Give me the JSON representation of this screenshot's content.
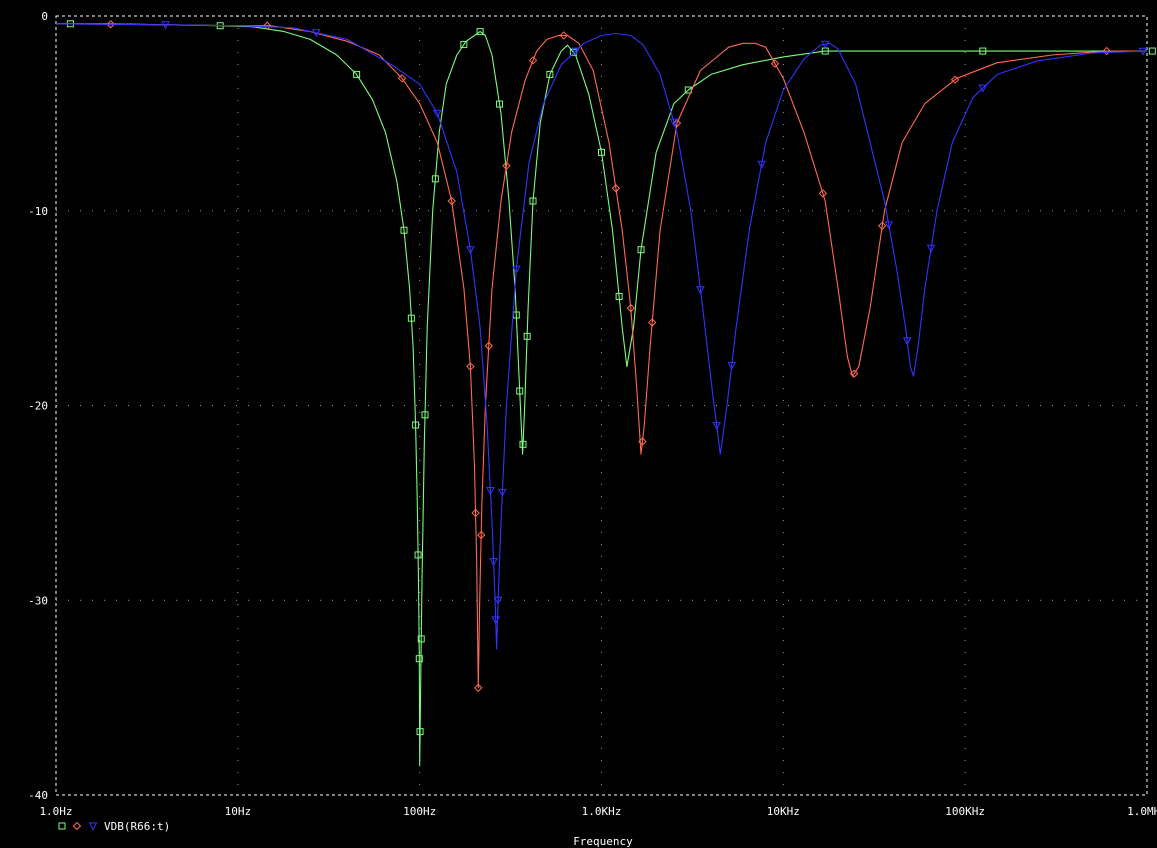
{
  "window": {},
  "chart_data": {
    "type": "line",
    "xscale": "log",
    "xlim": [
      1,
      1000000
    ],
    "ylim": [
      -40,
      0
    ],
    "xlabel": "Frequency",
    "ylabel": "",
    "grid": true,
    "x_ticks": [
      {
        "value": 1,
        "label": "1.0Hz"
      },
      {
        "value": 10,
        "label": "10Hz"
      },
      {
        "value": 100,
        "label": "100Hz"
      },
      {
        "value": 1000,
        "label": "1.0KHz"
      },
      {
        "value": 10000,
        "label": "10KHz"
      },
      {
        "value": 100000,
        "label": "100KHz"
      },
      {
        "value": 1000000,
        "label": "1.0MHz"
      }
    ],
    "y_ticks": [
      {
        "value": 0,
        "label": "0"
      },
      {
        "value": -10,
        "label": "-10"
      },
      {
        "value": -20,
        "label": "-20"
      },
      {
        "value": -30,
        "label": "-30"
      },
      {
        "value": -40,
        "label": "-40"
      }
    ],
    "legend": {
      "placement": "bottom-left",
      "text": "VDB(R66:t)"
    },
    "series": [
      {
        "color": "#7cfc7c",
        "marker": "square",
        "points": [
          [
            1.0,
            -0.4
          ],
          [
            2.0,
            -0.4
          ],
          [
            4.0,
            -0.45
          ],
          [
            8.0,
            -0.5
          ],
          [
            12,
            -0.55
          ],
          [
            18,
            -0.8
          ],
          [
            25,
            -1.2
          ],
          [
            35,
            -2.0
          ],
          [
            45,
            -3.0
          ],
          [
            55,
            -4.3
          ],
          [
            65,
            -6.0
          ],
          [
            75,
            -8.5
          ],
          [
            82,
            -11
          ],
          [
            88,
            -14
          ],
          [
            92,
            -17
          ],
          [
            95,
            -21
          ],
          [
            97,
            -25
          ],
          [
            98.5,
            -29
          ],
          [
            99.5,
            -33
          ],
          [
            100,
            -38.5
          ],
          [
            101,
            -35
          ],
          [
            103,
            -29
          ],
          [
            106,
            -22
          ],
          [
            110,
            -16
          ],
          [
            118,
            -10
          ],
          [
            128,
            -6
          ],
          [
            140,
            -3.5
          ],
          [
            160,
            -2.0
          ],
          [
            180,
            -1.3
          ],
          [
            200,
            -1.0
          ],
          [
            215,
            -0.8
          ],
          [
            230,
            -1.0
          ],
          [
            250,
            -2.0
          ],
          [
            280,
            -5.0
          ],
          [
            310,
            -9.5
          ],
          [
            335,
            -14
          ],
          [
            350,
            -18
          ],
          [
            360,
            -20.5
          ],
          [
            368,
            -22.5
          ],
          [
            378,
            -20
          ],
          [
            395,
            -15
          ],
          [
            420,
            -9.5
          ],
          [
            460,
            -5.5
          ],
          [
            520,
            -3
          ],
          [
            600,
            -1.8
          ],
          [
            650,
            -1.5
          ],
          [
            720,
            -2
          ],
          [
            850,
            -4
          ],
          [
            1000,
            -7
          ],
          [
            1150,
            -11
          ],
          [
            1300,
            -16
          ],
          [
            1380,
            -18
          ],
          [
            1500,
            -16
          ],
          [
            1650,
            -12
          ],
          [
            2000,
            -7
          ],
          [
            2500,
            -4.5
          ],
          [
            3000,
            -3.8
          ],
          [
            4000,
            -3
          ],
          [
            6000,
            -2.5
          ],
          [
            10000,
            -2.1
          ],
          [
            17000,
            -1.8
          ],
          [
            40000,
            -1.8
          ],
          [
            100000,
            -1.8
          ],
          [
            1000000,
            -1.8
          ]
        ],
        "marker_x": [
          1.2,
          8,
          45,
          82,
          90,
          95,
          98,
          99.5,
          100.5,
          102,
          107,
          122,
          175,
          215,
          275,
          340,
          355,
          370,
          390,
          420,
          520,
          700,
          1000,
          1250,
          1650,
          3000,
          17000,
          125000,
          1070000
        ]
      },
      {
        "color": "#ff6a50",
        "marker": "diamond",
        "points": [
          [
            1.0,
            -0.4
          ],
          [
            4.0,
            -0.45
          ],
          [
            10,
            -0.5
          ],
          [
            15,
            -0.5
          ],
          [
            25,
            -0.8
          ],
          [
            40,
            -1.3
          ],
          [
            60,
            -2.0
          ],
          [
            80,
            -3.2
          ],
          [
            100,
            -4.5
          ],
          [
            125,
            -6.5
          ],
          [
            150,
            -9.5
          ],
          [
            175,
            -14
          ],
          [
            190,
            -18
          ],
          [
            200,
            -23
          ],
          [
            206,
            -28
          ],
          [
            210,
            -34.5
          ],
          [
            214,
            -30
          ],
          [
            220,
            -25
          ],
          [
            230,
            -20
          ],
          [
            250,
            -14
          ],
          [
            280,
            -9.5
          ],
          [
            320,
            -6
          ],
          [
            380,
            -3.3
          ],
          [
            440,
            -1.8
          ],
          [
            500,
            -1.2
          ],
          [
            580,
            -1.0
          ],
          [
            650,
            -1.0
          ],
          [
            750,
            -1.4
          ],
          [
            900,
            -2.8
          ],
          [
            1100,
            -6.5
          ],
          [
            1300,
            -11
          ],
          [
            1450,
            -15
          ],
          [
            1560,
            -19
          ],
          [
            1650,
            -22.5
          ],
          [
            1720,
            -21
          ],
          [
            1850,
            -17
          ],
          [
            2100,
            -11
          ],
          [
            2600,
            -5.5
          ],
          [
            3500,
            -2.8
          ],
          [
            5000,
            -1.6
          ],
          [
            6000,
            -1.4
          ],
          [
            7000,
            -1.4
          ],
          [
            8000,
            -1.6
          ],
          [
            10000,
            -3.2
          ],
          [
            13000,
            -6
          ],
          [
            17000,
            -9.5
          ],
          [
            20000,
            -14
          ],
          [
            22500,
            -17.5
          ],
          [
            24000,
            -18.5
          ],
          [
            26000,
            -18
          ],
          [
            30000,
            -15
          ],
          [
            36000,
            -10
          ],
          [
            45000,
            -6.5
          ],
          [
            60000,
            -4.5
          ],
          [
            90000,
            -3.2
          ],
          [
            150000,
            -2.4
          ],
          [
            300000,
            -2.0
          ],
          [
            600000,
            -1.8
          ],
          [
            1000000,
            -1.8
          ]
        ],
        "marker_x": [
          2,
          14.5,
          80,
          150,
          190,
          203,
          210,
          218,
          240,
          300,
          420,
          620,
          1200,
          1450,
          1680,
          1900,
          2600,
          9000,
          16500,
          24500,
          35000,
          88000,
          600000
        ]
      },
      {
        "color": "#3333ff",
        "marker": "triangle",
        "points": [
          [
            1.0,
            -0.4
          ],
          [
            4.0,
            -0.45
          ],
          [
            10,
            -0.5
          ],
          [
            20,
            -0.6
          ],
          [
            40,
            -1.2
          ],
          [
            70,
            -2.5
          ],
          [
            100,
            -3.5
          ],
          [
            125,
            -5.0
          ],
          [
            160,
            -8.0
          ],
          [
            190,
            -12
          ],
          [
            215,
            -16
          ],
          [
            235,
            -21
          ],
          [
            250,
            -26
          ],
          [
            260,
            -30
          ],
          [
            265,
            -32.5
          ],
          [
            270,
            -30
          ],
          [
            280,
            -26
          ],
          [
            300,
            -20
          ],
          [
            340,
            -13
          ],
          [
            400,
            -7.5
          ],
          [
            480,
            -4.5
          ],
          [
            600,
            -2.5
          ],
          [
            800,
            -1.4
          ],
          [
            1000,
            -1.0
          ],
          [
            1200,
            -0.9
          ],
          [
            1450,
            -1.0
          ],
          [
            1700,
            -1.5
          ],
          [
            2100,
            -3
          ],
          [
            2600,
            -6
          ],
          [
            3100,
            -10
          ],
          [
            3600,
            -15
          ],
          [
            4100,
            -19.5
          ],
          [
            4500,
            -22.5
          ],
          [
            4900,
            -20
          ],
          [
            5500,
            -16
          ],
          [
            6500,
            -11
          ],
          [
            8000,
            -6.5
          ],
          [
            10000,
            -3.8
          ],
          [
            13000,
            -2.2
          ],
          [
            16000,
            -1.5
          ],
          [
            18000,
            -1.4
          ],
          [
            20000,
            -1.7
          ],
          [
            25000,
            -3.5
          ],
          [
            30000,
            -6.5
          ],
          [
            36000,
            -9.5
          ],
          [
            42000,
            -13
          ],
          [
            47000,
            -16
          ],
          [
            50000,
            -18
          ],
          [
            52000,
            -18.5
          ],
          [
            55000,
            -17
          ],
          [
            60000,
            -14
          ],
          [
            70000,
            -10
          ],
          [
            85000,
            -6.5
          ],
          [
            110000,
            -4.2
          ],
          [
            150000,
            -3
          ],
          [
            250000,
            -2.3
          ],
          [
            500000,
            -1.9
          ],
          [
            1000000,
            -1.8
          ]
        ],
        "marker_x": [
          4,
          27,
          125,
          190,
          245,
          255,
          262,
          270,
          285,
          340,
          720,
          2500,
          3500,
          4300,
          5200,
          7600,
          17000,
          38000,
          48000,
          65000,
          125000,
          950000
        ]
      }
    ]
  }
}
